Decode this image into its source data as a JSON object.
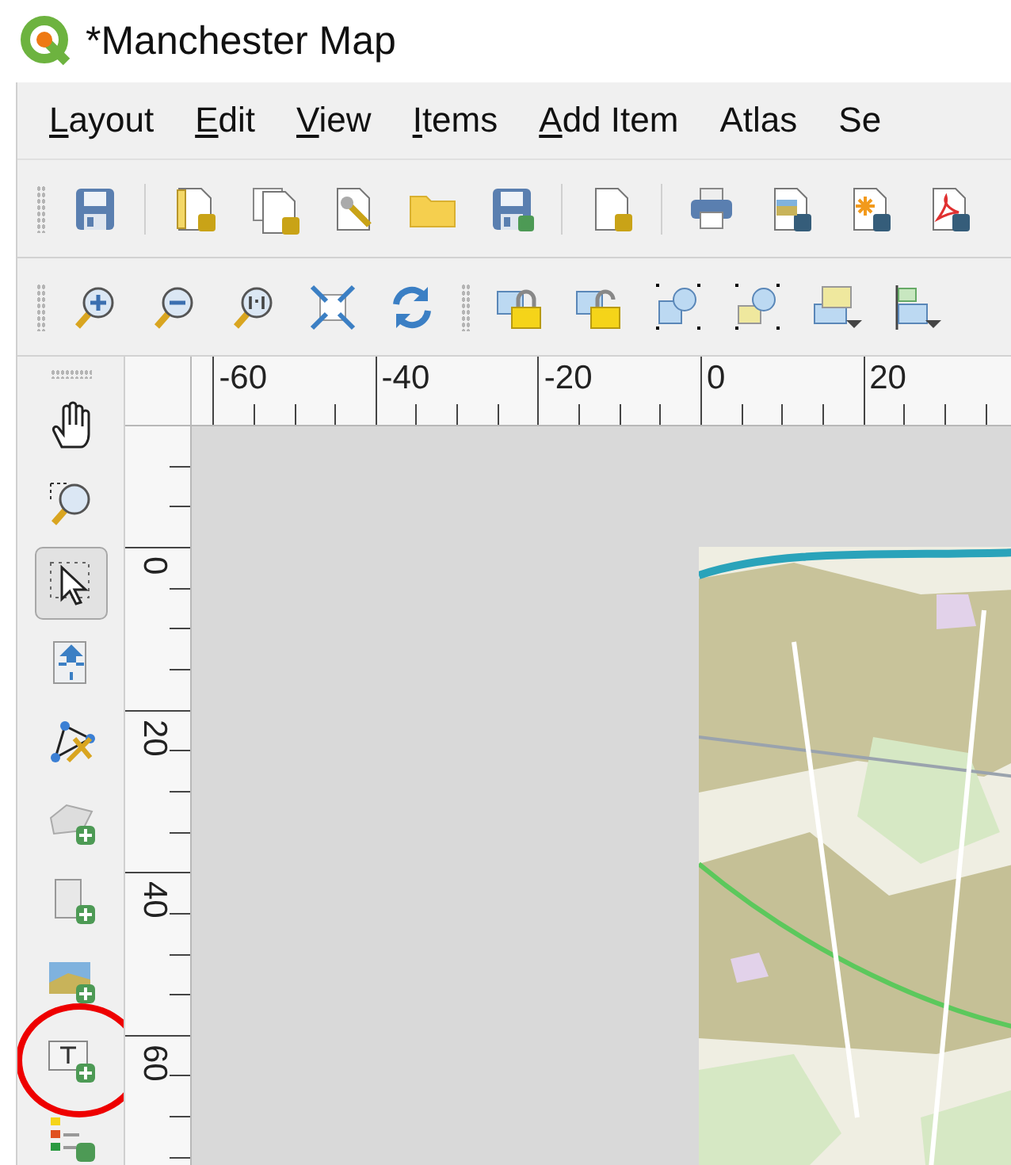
{
  "window": {
    "title": "*Manchester Map"
  },
  "menu": [
    {
      "label": "Layout",
      "mnemonic": true
    },
    {
      "label": "Edit",
      "mnemonic": true
    },
    {
      "label": "View",
      "mnemonic": true
    },
    {
      "label": "Items",
      "mnemonic": true
    },
    {
      "label": "Add Item",
      "mnemonic": true
    },
    {
      "label": "Atlas",
      "mnemonic": false
    },
    {
      "label": "Se",
      "mnemonic": false
    }
  ],
  "tools": [
    {
      "selected": false,
      "highlighted": false
    },
    {
      "selected": false,
      "highlighted": false
    },
    {
      "selected": true,
      "highlighted": false
    },
    {
      "selected": false,
      "highlighted": false
    },
    {
      "selected": false,
      "highlighted": false
    },
    {
      "selected": false,
      "highlighted": false
    },
    {
      "selected": false,
      "highlighted": false
    },
    {
      "selected": false,
      "highlighted": false
    },
    {
      "selected": false,
      "highlighted": true
    },
    {
      "selected": false,
      "highlighted": false
    }
  ],
  "ruler_horizontal": [
    "-60",
    "-40",
    "-20",
    "0",
    "20"
  ],
  "ruler_vertical": [
    "0",
    "20",
    "40",
    "60"
  ]
}
